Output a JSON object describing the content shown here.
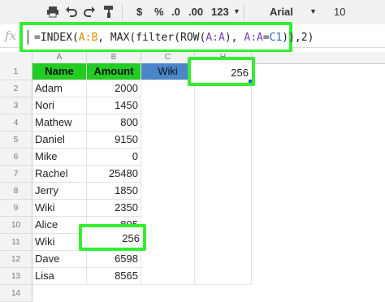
{
  "toolbar": {
    "currency": "$",
    "percent": "%",
    "decimals_less": ".0",
    "decimals_more": ".00",
    "more_formats": "123",
    "font": "Arial",
    "font_size": "10"
  },
  "formula_bar": {
    "fx_label": "fx",
    "formula": "=INDEX(A:B, MAX(filter(ROW(A:A), A:A=C1)),2)"
  },
  "columns": [
    "A",
    "B",
    "C",
    "H"
  ],
  "rows": [
    "1",
    "2",
    "3",
    "4",
    "5",
    "6",
    "7",
    "8",
    "9",
    "10",
    "11",
    "12",
    "13",
    "14"
  ],
  "sheet": {
    "header_name": "Name",
    "header_amount": "Amount",
    "lookup_value": "Wiki",
    "result": "256",
    "data": [
      {
        "name": "Adam",
        "amount": "2000"
      },
      {
        "name": "Nori",
        "amount": "1450"
      },
      {
        "name": "Mathew",
        "amount": "800"
      },
      {
        "name": "Daniel",
        "amount": "9150"
      },
      {
        "name": "Mike",
        "amount": "0"
      },
      {
        "name": "Rachel",
        "amount": "25480"
      },
      {
        "name": "Jerry",
        "amount": "1850"
      },
      {
        "name": "Wiki",
        "amount": "2350"
      },
      {
        "name": "Alice",
        "amount": "895"
      },
      {
        "name": "Wiki",
        "amount": "256"
      },
      {
        "name": "Dave",
        "amount": "6598"
      },
      {
        "name": "Lisa",
        "amount": "8565"
      }
    ]
  },
  "colors": {
    "highlight": "#33ee33",
    "header_green": "#22cc22",
    "header_blue": "#4a86c8"
  }
}
